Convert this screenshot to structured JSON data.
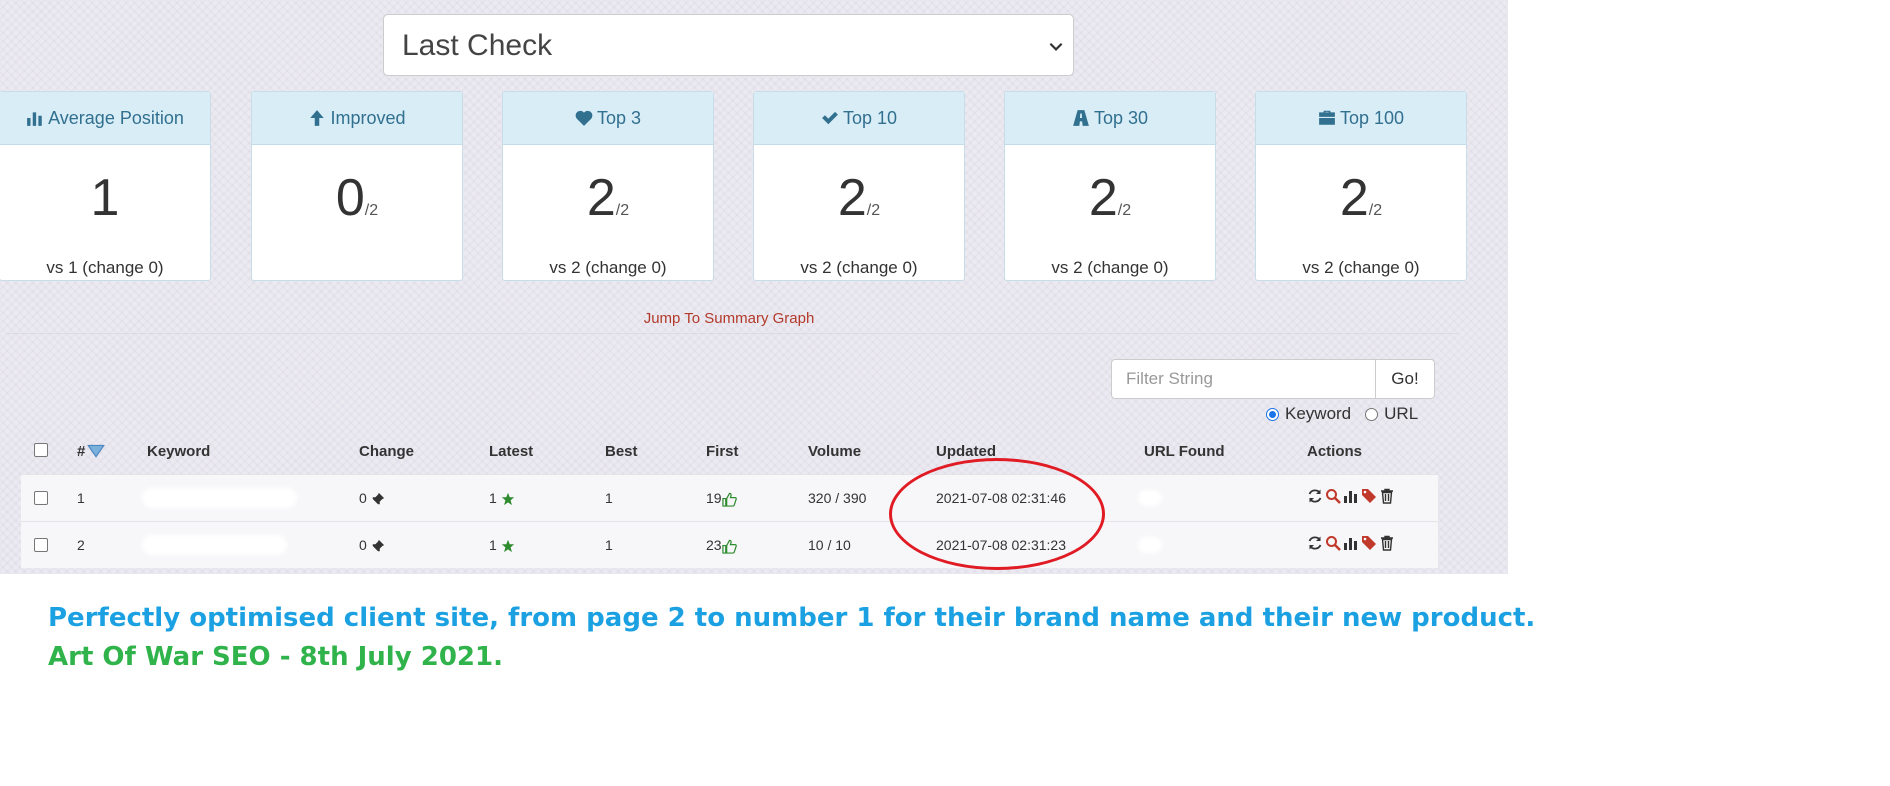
{
  "period_select": {
    "value": "Last Check"
  },
  "cards": [
    {
      "title": "Average Position",
      "icon": "bar-chart-icon",
      "value": "1",
      "denominator": "",
      "footer": "vs 1 (change 0)"
    },
    {
      "title": "Improved",
      "icon": "arrow-up-icon",
      "value": "0",
      "denominator": "/2",
      "footer": ""
    },
    {
      "title": "Top 3",
      "icon": "heart-icon",
      "value": "2",
      "denominator": "/2",
      "footer": "vs 2 (change 0)"
    },
    {
      "title": "Top 10",
      "icon": "check-icon",
      "value": "2",
      "denominator": "/2",
      "footer": "vs 2 (change 0)"
    },
    {
      "title": "Top 30",
      "icon": "road-icon",
      "value": "2",
      "denominator": "/2",
      "footer": "vs 2 (change 0)"
    },
    {
      "title": "Top 100",
      "icon": "briefcase-icon",
      "value": "2",
      "denominator": "/2",
      "footer": "vs 2 (change 0)"
    }
  ],
  "jump_link": "Jump To Summary Graph",
  "filter": {
    "placeholder": "Filter String",
    "go_label": "Go!",
    "options": [
      "Keyword",
      "URL"
    ],
    "selected": "Keyword"
  },
  "table": {
    "headers": [
      "#",
      "Keyword",
      "Change",
      "Latest",
      "Best",
      "First",
      "Volume",
      "Updated",
      "URL Found",
      "Actions"
    ],
    "rows": [
      {
        "num": "1",
        "change": "0",
        "latest": "1",
        "best": "1",
        "first": "19",
        "volume": "320 / 390",
        "updated": "2021-07-08 02:31:46"
      },
      {
        "num": "2",
        "change": "0",
        "latest": "1",
        "best": "1",
        "first": "23",
        "volume": "10 / 10",
        "updated": "2021-07-08 02:31:23"
      }
    ]
  },
  "captions": {
    "line1": "Perfectly optimised client site, from page 2 to number 1 for their brand name and their new product.",
    "line2": "Art Of War SEO - 8th July 2021."
  },
  "colors": {
    "accent_blue": "#1ba1e2",
    "accent_green": "#2fb34a",
    "circle_red": "#e01b24",
    "card_head": "#d9edf7"
  }
}
